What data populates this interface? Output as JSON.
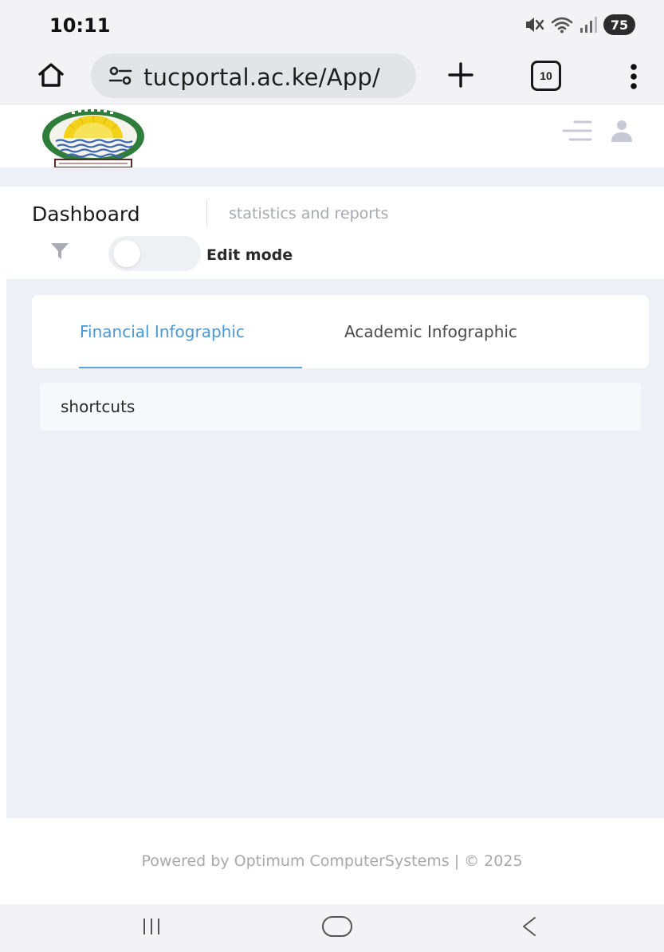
{
  "status_bar": {
    "time": "10:11",
    "battery": "75",
    "icons": [
      "mute-vibrate-icon",
      "wifi-icon",
      "signal-icon",
      "battery-icon"
    ]
  },
  "browser": {
    "url": "tucportal.ac.ke/App/",
    "open_tabs": "10",
    "icons": [
      "home-icon",
      "site-settings-icon",
      "plus-icon",
      "tabs-icon",
      "more-vert-icon"
    ]
  },
  "header": {
    "logo_icon": "university-crest-logo",
    "icons": [
      "menu-lines-icon",
      "user-icon"
    ]
  },
  "page": {
    "title": "Dashboard",
    "subtitle": "statistics and reports",
    "edit_mode_label": "Edit mode",
    "edit_mode_on": false
  },
  "tabs": [
    {
      "label": "Financial Infographic",
      "active": true
    },
    {
      "label": "Academic Infographic",
      "active": false
    }
  ],
  "shortcuts": {
    "label": "shortcuts"
  },
  "footer": {
    "text": "Powered by Optimum ComputerSystems | © 2025"
  },
  "colors": {
    "accent": "#4a97d4",
    "page_background": "#eef0f8",
    "muted_text": "#a6a8ae"
  }
}
